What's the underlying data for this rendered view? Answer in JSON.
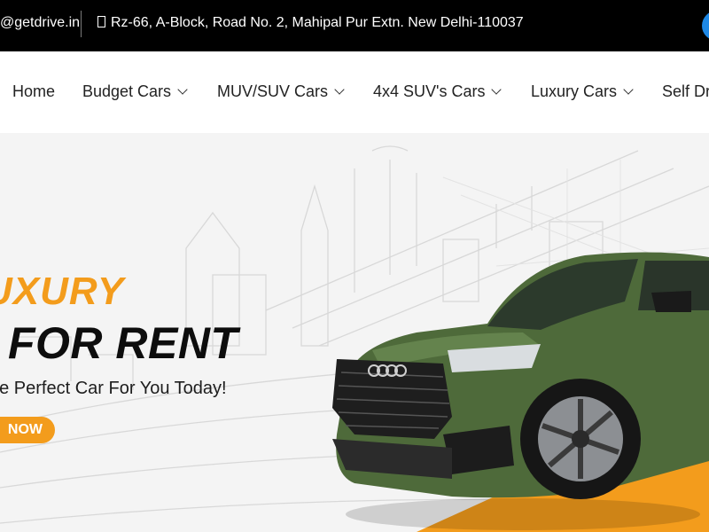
{
  "topbar": {
    "email": "@getdrive.in",
    "address": "Rz-66, A-Block, Road No. 2, Mahipal Pur Extn. New Delhi-110037",
    "address_icon": "map-pin-icon"
  },
  "nav": {
    "items": [
      {
        "label": "Home",
        "dropdown": false
      },
      {
        "label": "Budget Cars",
        "dropdown": true
      },
      {
        "label": "MUV/SUV Cars",
        "dropdown": true
      },
      {
        "label": "4x4 SUV's Cars",
        "dropdown": true
      },
      {
        "label": "Luxury Cars",
        "dropdown": true
      },
      {
        "label": "Self Dr",
        "dropdown": false
      }
    ]
  },
  "hero": {
    "eyebrow": "UXURY",
    "headline": "R FOR RENT",
    "tagline": "ne Perfect Car For You Today!",
    "cta_label": "NOW",
    "accent_color": "#f39c1c",
    "car_color": "#4e6a3a"
  }
}
